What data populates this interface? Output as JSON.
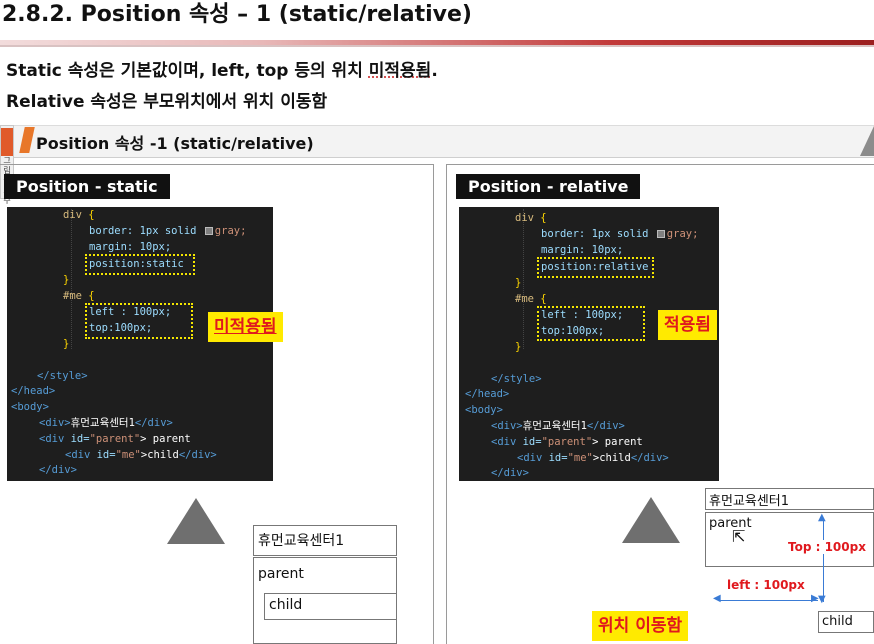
{
  "title": "2.8.2. Position 속성 – 1 (static/relative)",
  "description": {
    "line1_pre": "Static 속성은 기본값이며, left, top 등의 위치 ",
    "line1_underlined": "미적용됨",
    "line1_post": ".",
    "line2": "Relative 속성은 부모위치에서 위치 이동함"
  },
  "embed_bar": {
    "icon_text": "그림을표수",
    "title": "Position 속성 -1 (static/relative)"
  },
  "left_panel": {
    "label": "Position - static",
    "code": {
      "div_sel": "div ",
      "border_prop": "border: 1px solid ",
      "border_color": "gray;",
      "margin": "margin: 10px;",
      "position": "position:static",
      "me_sel": "#me ",
      "left": "left : 100px;",
      "top": "top:100px;",
      "close_style": "</style>",
      "close_head": "</head>",
      "open_body": "<body>",
      "div1_open": "<div>",
      "div1_text": "휴먼교육센터1",
      "div1_close": "</div>",
      "div_parent_open": "<div ",
      "id_attr": "id=",
      "parent_id": "\"parent\"",
      "parent_text": "> parent",
      "me_id": "\"me\"",
      "child_text": ">child",
      "div_close": "</div>"
    },
    "badge": "미적용됨",
    "demo": {
      "center": "휴먼교육센터1",
      "parent": "parent",
      "child": "child"
    }
  },
  "right_panel": {
    "label": "Position - relative",
    "code": {
      "position": "position:relative"
    },
    "badge": "적용됨",
    "demo": {
      "center": "휴먼교육센터1",
      "parent": "parent",
      "child": "child",
      "top_label": "Top : 100px",
      "left_label": "left : 100px"
    },
    "bottom_badge": "위치 이동함"
  }
}
